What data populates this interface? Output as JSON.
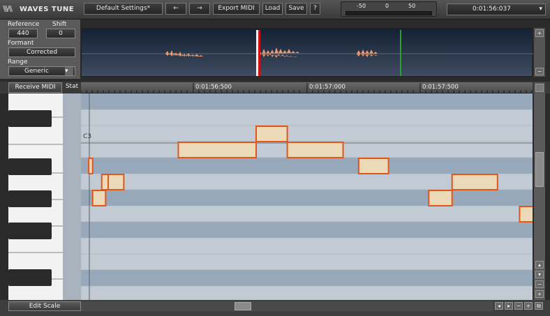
{
  "app": {
    "logo_text": "WAVES TUNE",
    "logo_mark": "\\\\\\/\\\\"
  },
  "toolbar": {
    "preset": "Default Settings*",
    "prev_label": "←",
    "next_label": "→",
    "export_midi": "Export MIDI",
    "load": "Load",
    "save": "Save",
    "help": "?"
  },
  "meter": {
    "ticks": [
      "-50",
      "0",
      "50"
    ]
  },
  "time": {
    "value": "0:01:56:037",
    "dropdown": "▾"
  },
  "left_panel": {
    "reference_label": "Reference",
    "reference_value": "440",
    "shift_label": "Shift",
    "shift_value": "0",
    "formant_label": "Formant",
    "formant_value": "Corrected",
    "range_label": "Range",
    "range_value": "Generic",
    "range_arrow": "▾"
  },
  "header": {
    "receive_midi": "Receive MIDI",
    "stat": "Stat"
  },
  "ruler": {
    "markers": [
      "0:01:56:500",
      "0:01:57:000",
      "0:01:57:500"
    ]
  },
  "grid": {
    "note_label": "C3"
  },
  "footer": {
    "edit_scale": "Edit Scale"
  },
  "scroll": {
    "up": "▴",
    "down": "▾",
    "plus": "+",
    "minus": "−",
    "left": "◂",
    "right": "▸",
    "fit": "⧉"
  },
  "notes": [
    {
      "start": 0.375,
      "end": 0.675,
      "row": 3
    },
    {
      "start": 0.675,
      "end": 0.795,
      "row": 2
    },
    {
      "start": 0.795,
      "end": 1.01,
      "row": 3
    },
    {
      "start": 1.07,
      "end": 1.185,
      "row": 4
    },
    {
      "start": 0.03,
      "end": 0.045,
      "row": 4
    },
    {
      "start": 0.045,
      "end": 0.095,
      "row": 6
    },
    {
      "start": 0.08,
      "end": 0.105,
      "row": 5
    },
    {
      "start": 0.105,
      "end": 0.165,
      "row": 5
    },
    {
      "start": 1.34,
      "end": 1.43,
      "row": 6
    },
    {
      "start": 1.43,
      "end": 1.605,
      "row": 5
    },
    {
      "start": 1.69,
      "end": 1.75,
      "row": 7
    }
  ],
  "colors": {
    "note_fill": "#ecd9b8",
    "note_border": "#e2561a",
    "lane_dark": "#97a8bb",
    "lane_light": "#c2cad3",
    "playhead": "#cc1111",
    "cursor": "#27a034"
  }
}
